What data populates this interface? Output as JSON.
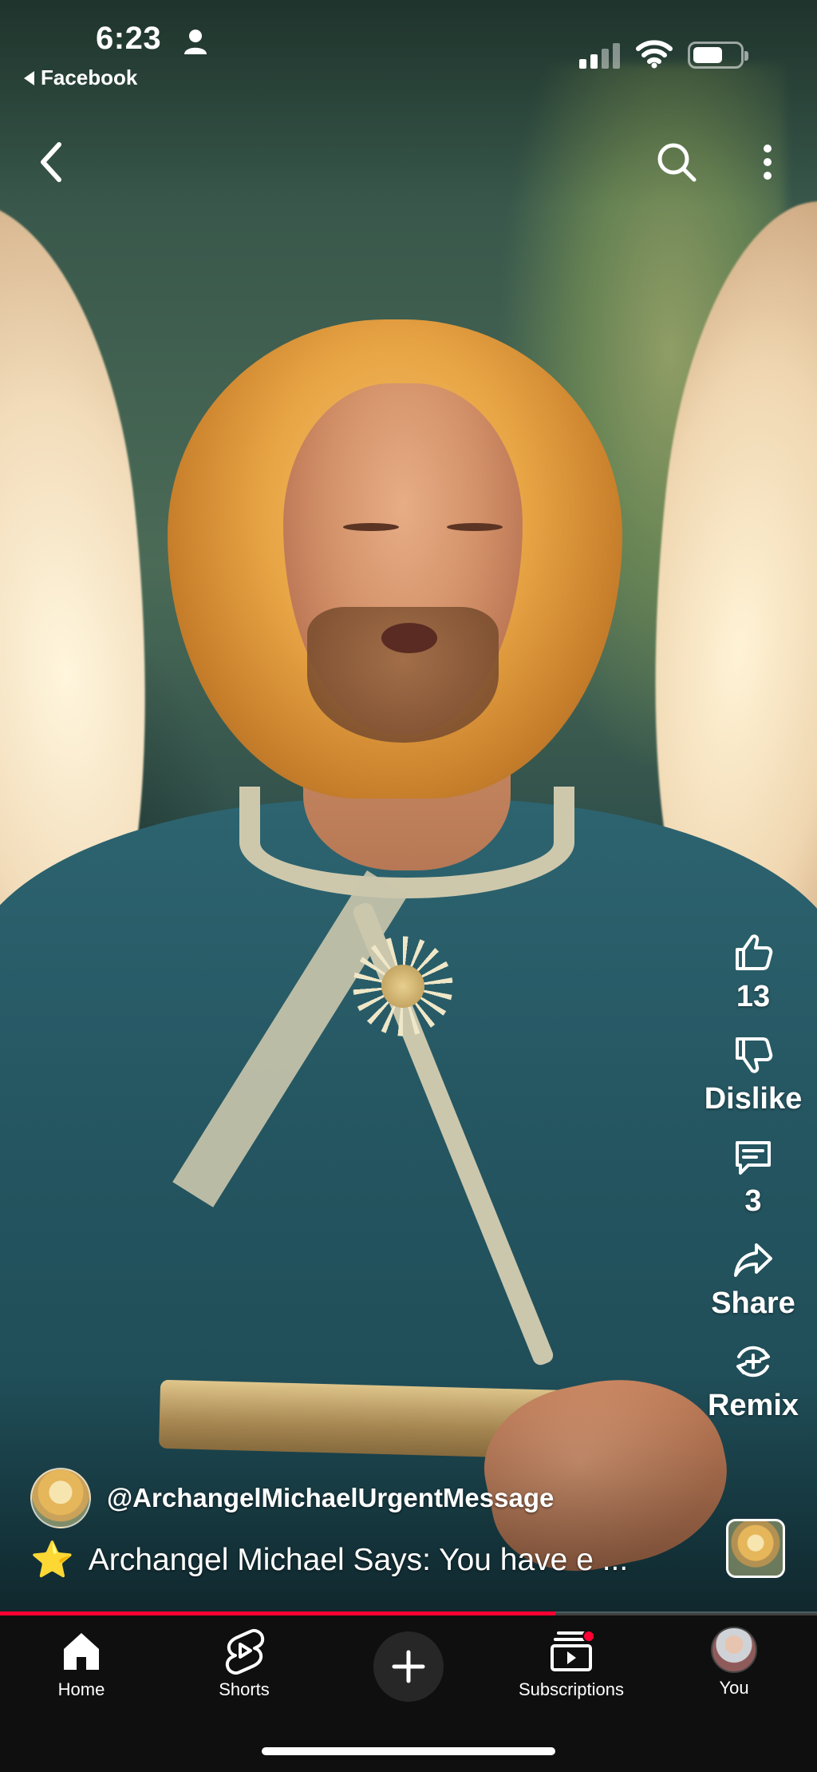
{
  "status_bar": {
    "time": "6:23",
    "back_app_label": "Facebook"
  },
  "top_bar": {
    "back_icon": "chevron-left-icon",
    "search_icon": "search-icon",
    "more_icon": "more-vertical-icon"
  },
  "actions": {
    "like_count": "13",
    "dislike_label": "Dislike",
    "comment_count": "3",
    "share_label": "Share",
    "remix_label": "Remix"
  },
  "video": {
    "channel_handle": "@ArchangelMichaelUrgentMessage",
    "title_emoji": "⭐",
    "title": "Archangel Michael Says: You have e ...",
    "progress_fraction": 0.68
  },
  "bottom_nav": {
    "items": [
      {
        "label": "Home",
        "icon": "home-icon"
      },
      {
        "label": "Shorts",
        "icon": "shorts-icon"
      },
      {
        "label": "",
        "icon": "plus-icon"
      },
      {
        "label": "Subscriptions",
        "icon": "subscriptions-icon"
      },
      {
        "label": "You",
        "icon": "avatar"
      }
    ]
  },
  "colors": {
    "accent": "#ff0033",
    "nav_background": "#0f0f0f"
  }
}
